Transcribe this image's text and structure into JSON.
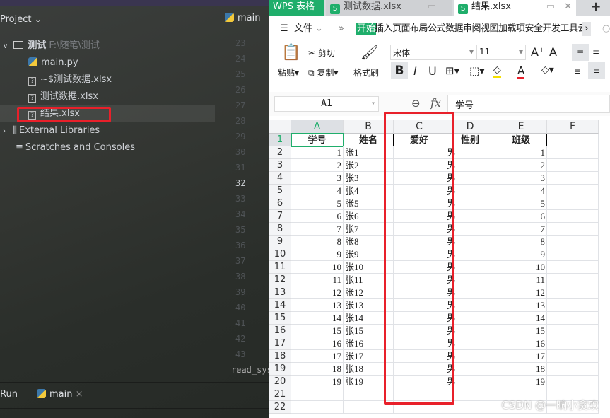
{
  "ide": {
    "project_label": "Project",
    "root_folder": "测试",
    "root_path": "F:\\随笔\\测试",
    "files": [
      "main.py",
      "~$测试数据.xlsx",
      "测试数据.xlsx",
      "结果.xlsx"
    ],
    "external_libraries": "External Libraries",
    "scratches": "Scratches and Consoles",
    "editor_tab": "main",
    "line_numbers": [
      "23",
      "24",
      "25",
      "26",
      "27",
      "28",
      "29",
      "30",
      "31",
      "32",
      "33",
      "34",
      "35",
      "36",
      "37",
      "38",
      "39",
      "40",
      "41",
      "42",
      "43"
    ],
    "current_line": "32",
    "breadcrumb": "read_sys",
    "run_label": "Run",
    "run_tab": "main"
  },
  "wps": {
    "app_tab": "WPS 表格",
    "doc_tabs": [
      "测试数据.xlsx",
      "结果.xlsx"
    ],
    "active_doc": "结果.xlsx",
    "menu": {
      "file": "文件",
      "active": "开始",
      "items": "插入页面布局公式数据审阅视图加载项安全开发工具云服"
    },
    "ribbon": {
      "paste": "粘贴",
      "cut": "剪切",
      "copy": "复制",
      "format_painter": "格式刷",
      "font": "宋体",
      "size": "11"
    },
    "cell_ref": "A1",
    "fx": "fx",
    "formula_value": "学号",
    "columns": [
      "A",
      "B",
      "C",
      "D",
      "E",
      "F"
    ],
    "rows": [
      [
        "学号",
        "姓名",
        "爱好",
        "性别",
        "班级"
      ],
      [
        "1",
        "张1",
        "",
        "男",
        "1"
      ],
      [
        "2",
        "张2",
        "",
        "男",
        "2"
      ],
      [
        "3",
        "张3",
        "",
        "男",
        "3"
      ],
      [
        "4",
        "张4",
        "",
        "男",
        "4"
      ],
      [
        "5",
        "张5",
        "",
        "男",
        "5"
      ],
      [
        "6",
        "张6",
        "",
        "男",
        "6"
      ],
      [
        "7",
        "张7",
        "",
        "男",
        "7"
      ],
      [
        "8",
        "张8",
        "",
        "男",
        "8"
      ],
      [
        "9",
        "张9",
        "",
        "男",
        "9"
      ],
      [
        "10",
        "张10",
        "",
        "男",
        "10"
      ],
      [
        "11",
        "张11",
        "",
        "男",
        "11"
      ],
      [
        "12",
        "张12",
        "",
        "男",
        "12"
      ],
      [
        "13",
        "张13",
        "",
        "男",
        "13"
      ],
      [
        "14",
        "张14",
        "",
        "男",
        "14"
      ],
      [
        "15",
        "张15",
        "",
        "男",
        "15"
      ],
      [
        "16",
        "张16",
        "",
        "男",
        "16"
      ],
      [
        "17",
        "张17",
        "",
        "男",
        "17"
      ],
      [
        "18",
        "张18",
        "",
        "男",
        "18"
      ],
      [
        "19",
        "张19",
        "",
        "男",
        "19"
      ],
      [
        "",
        "",
        "",
        "",
        ""
      ],
      [
        "",
        "",
        "",
        "",
        ""
      ]
    ],
    "watermark": "CSDN @一晌小贪欢",
    "accent": "#1fae6b",
    "highlight": "#e8202a"
  }
}
